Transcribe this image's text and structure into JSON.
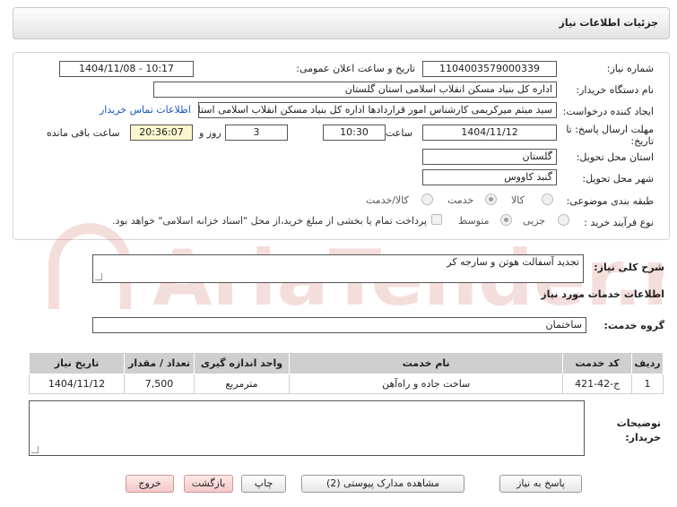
{
  "header": {
    "title": "جزئیات اطلاعات نیاز"
  },
  "form": {
    "need_number_label": "شماره نیاز:",
    "need_number": "1104003579000339",
    "announce_label": "تاریخ و ساعت اعلان عمومی:",
    "announce_value": "1404/11/08 - 10:17",
    "buyer_org_label": "نام دستگاه خریدار:",
    "buyer_org": "اداره کل بنیاد مسکن انقلاب اسلامی استان گلستان",
    "creator_label": "ایجاد کننده درخواست:",
    "creator": "سید میثم میرکریمی کارشناس امور قراردادها اداره کل بنیاد مسکن انقلاب اسلامی استان گلستان",
    "contact_link": "اطلاعات تماس خریدار",
    "deadline_label_1": "مهلت ارسال پاسخ: تا",
    "deadline_label_2": "تاریخ:",
    "deadline_date": "1404/11/12",
    "time_label": "ساعت",
    "deadline_time": "10:30",
    "days_value": "3",
    "days_label": "روز و",
    "remaining_time": "20:36:07",
    "remaining_label": "ساعت باقی مانده",
    "province_label": "استان محل تحویل:",
    "province": "گلستان",
    "city_label": "شهر محل تحویل:",
    "city": "گنبد کاووس",
    "category_label": "طبقه بندی موضوعی:",
    "category_options": [
      "کالا",
      "خدمت",
      "کالا/خدمت"
    ],
    "process_label": "نوع فرآیند خرید :",
    "process_options": [
      "جزیی",
      "متوسط"
    ],
    "payment_note": "پرداخت تمام یا بخشی از مبلغ خرید،از محل \"اسناد خزانه اسلامی\" خواهد بود."
  },
  "summary": {
    "label": "شرح کلی نیاز:",
    "value": "تجدید آسفالت هوتن و سارجه کر"
  },
  "services": {
    "title": "اطلاعات خدمات مورد نیاز",
    "group_label": "گروه خدمت:",
    "group_value": "ساختمان"
  },
  "table": {
    "headers": [
      "ردیف",
      "کد خدمت",
      "نام خدمت",
      "واحد اندازه گیری",
      "تعداد / مقدار",
      "تاریخ نیاز"
    ],
    "rows": [
      [
        "1",
        "ج-42-421",
        "ساخت جاده و راه‌آهن",
        "مترمربع",
        "7,500",
        "1404/11/12"
      ]
    ]
  },
  "buyer_notes": {
    "label_1": "توضیحات",
    "label_2": "خریدار:"
  },
  "buttons": {
    "reply": "پاسخ به نیاز",
    "documents": "مشاهده مدارک پیوستی (2)",
    "print": "چاپ",
    "back": "بازگشت",
    "exit": "خروج"
  },
  "watermark": {
    "text": "AriaTender.net"
  },
  "colors": {
    "link": "#1a56c4",
    "yellow_box": "#fbf6cf",
    "table_header": "#cfcfcf",
    "exit_button": "#f5c7c7",
    "watermark": "#c0392b"
  }
}
